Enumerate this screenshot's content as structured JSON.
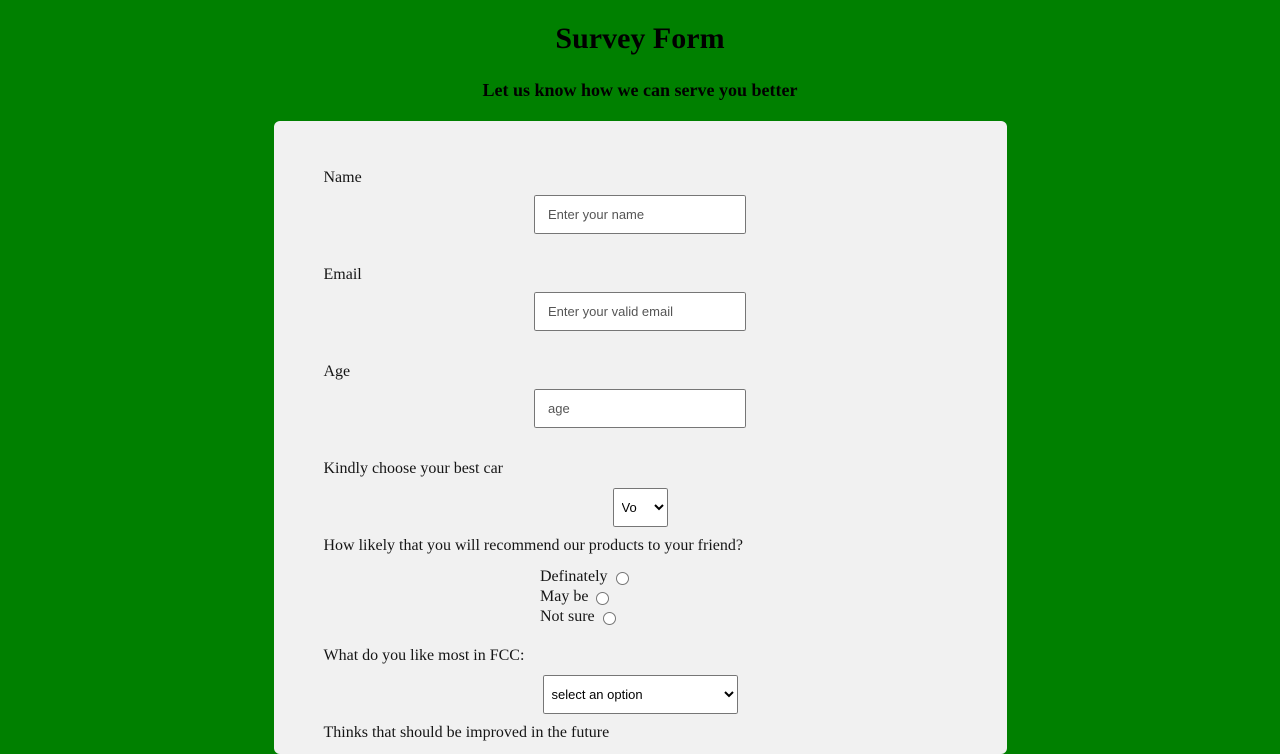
{
  "title": "Survey Form",
  "subtitle": "Let us know how we can serve you better",
  "fields": {
    "name": {
      "label": "Name",
      "placeholder": "Enter your name"
    },
    "email": {
      "label": "Email",
      "placeholder": "Enter your valid email"
    },
    "age": {
      "label": "Age",
      "placeholder": "age"
    },
    "best_car": {
      "label": "Kindly choose your best car",
      "selected": "Vo"
    },
    "recommend": {
      "label": "How likely that you will recommend our products to your friend?",
      "options": [
        "Definately",
        "May be",
        "Not sure"
      ]
    },
    "fcc_like": {
      "label": "What do you like most in FCC:",
      "selected": "select an option"
    },
    "improvements": {
      "label": "Thinks that should be improved in the future"
    }
  }
}
